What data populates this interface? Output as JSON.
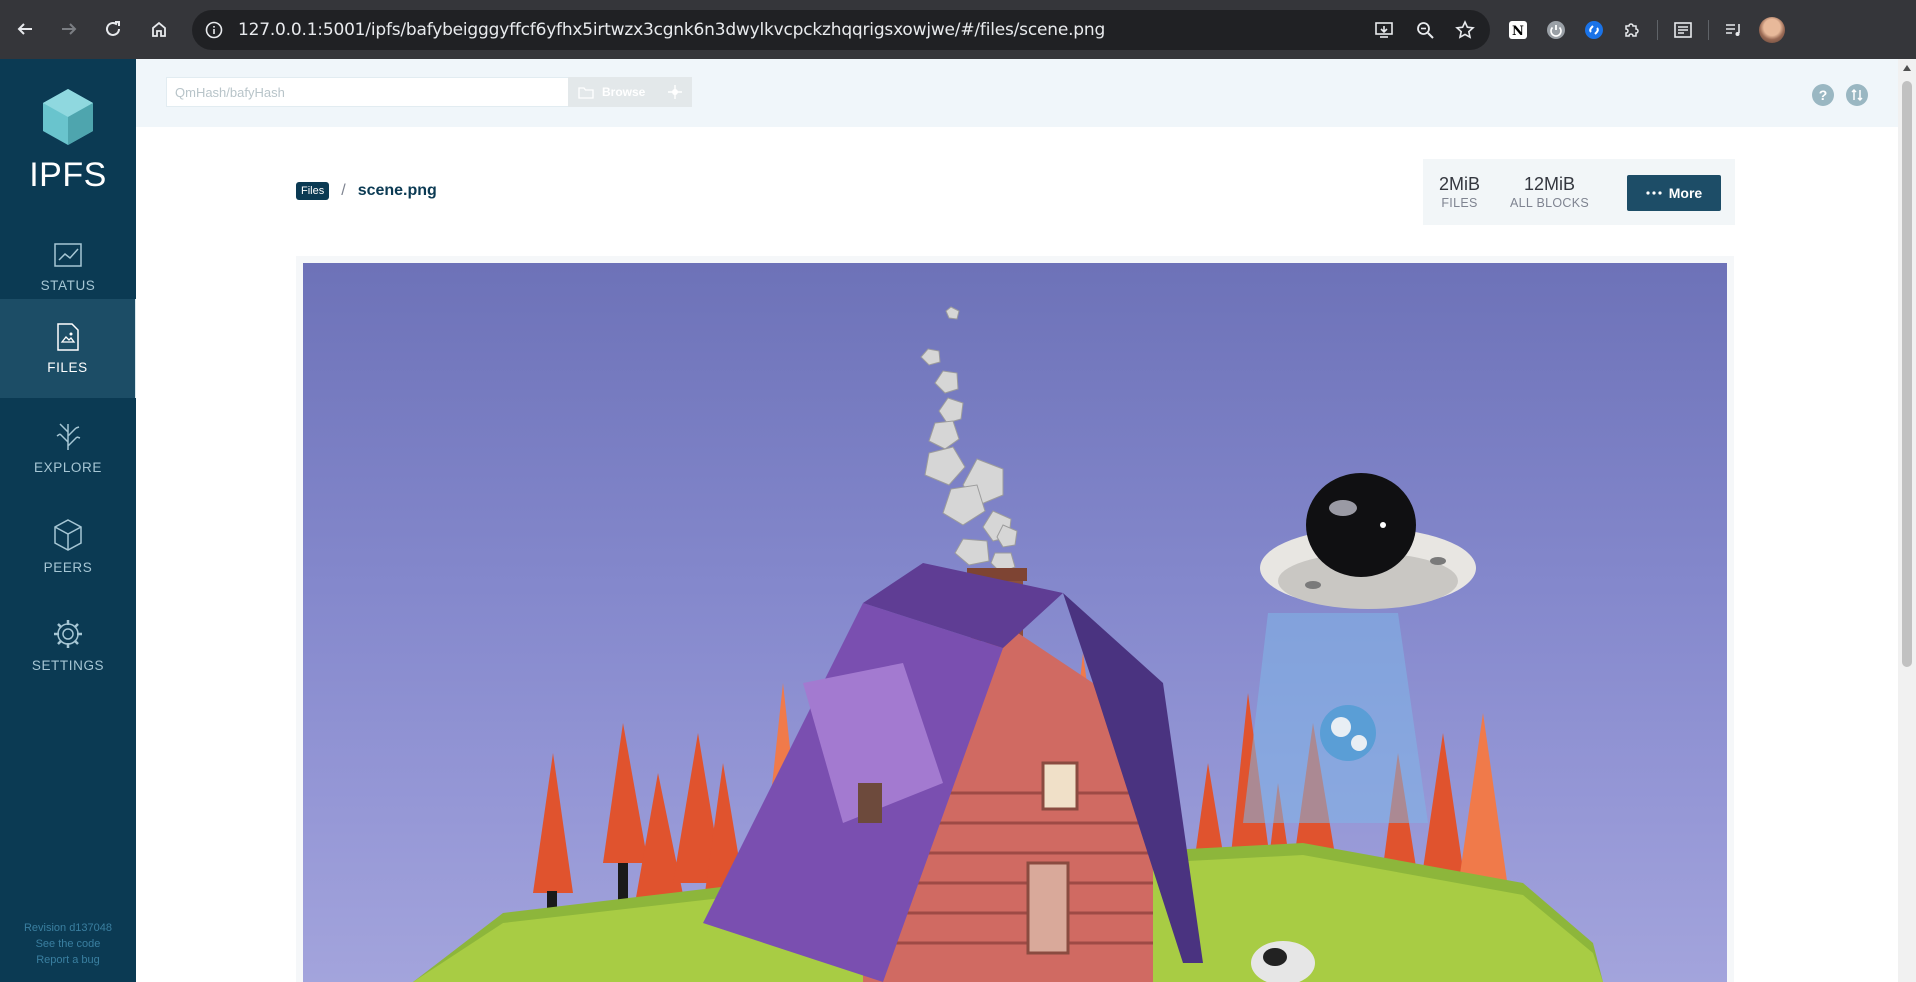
{
  "browser": {
    "url": "127.0.0.1:5001/ipfs/bafybeigggyffcf6yfhx5irtwzx3cgnk6n3dwylkvcpckzhqqrigsxowjwe/#/files/scene.png"
  },
  "sidebar": {
    "logo_text": "IPFS",
    "items": [
      {
        "label": "STATUS",
        "icon": "status-chart-icon"
      },
      {
        "label": "FILES",
        "icon": "files-icon",
        "active": true
      },
      {
        "label": "EXPLORE",
        "icon": "explore-tree-icon"
      },
      {
        "label": "PEERS",
        "icon": "peers-cube-icon"
      },
      {
        "label": "SETTINGS",
        "icon": "settings-gear-icon"
      }
    ],
    "footer": {
      "revision": "Revision d137048",
      "see_code": "See the code",
      "report_bug": "Report a bug"
    }
  },
  "topbar": {
    "search_placeholder": "QmHash/bafyHash",
    "browse_label": "Browse"
  },
  "breadcrumb": {
    "root": "Files",
    "separator": "/",
    "current": "scene.png"
  },
  "stats": {
    "files_value": "2MiB",
    "files_label": "FILES",
    "blocks_value": "12MiB",
    "blocks_label": "ALL BLOCKS"
  },
  "more_button": "More",
  "colors": {
    "sidebar_bg": "#0b3a53",
    "sidebar_active": "#1c4d66",
    "accent": "#1d4d67",
    "logo_teal": "#69c4cd"
  }
}
